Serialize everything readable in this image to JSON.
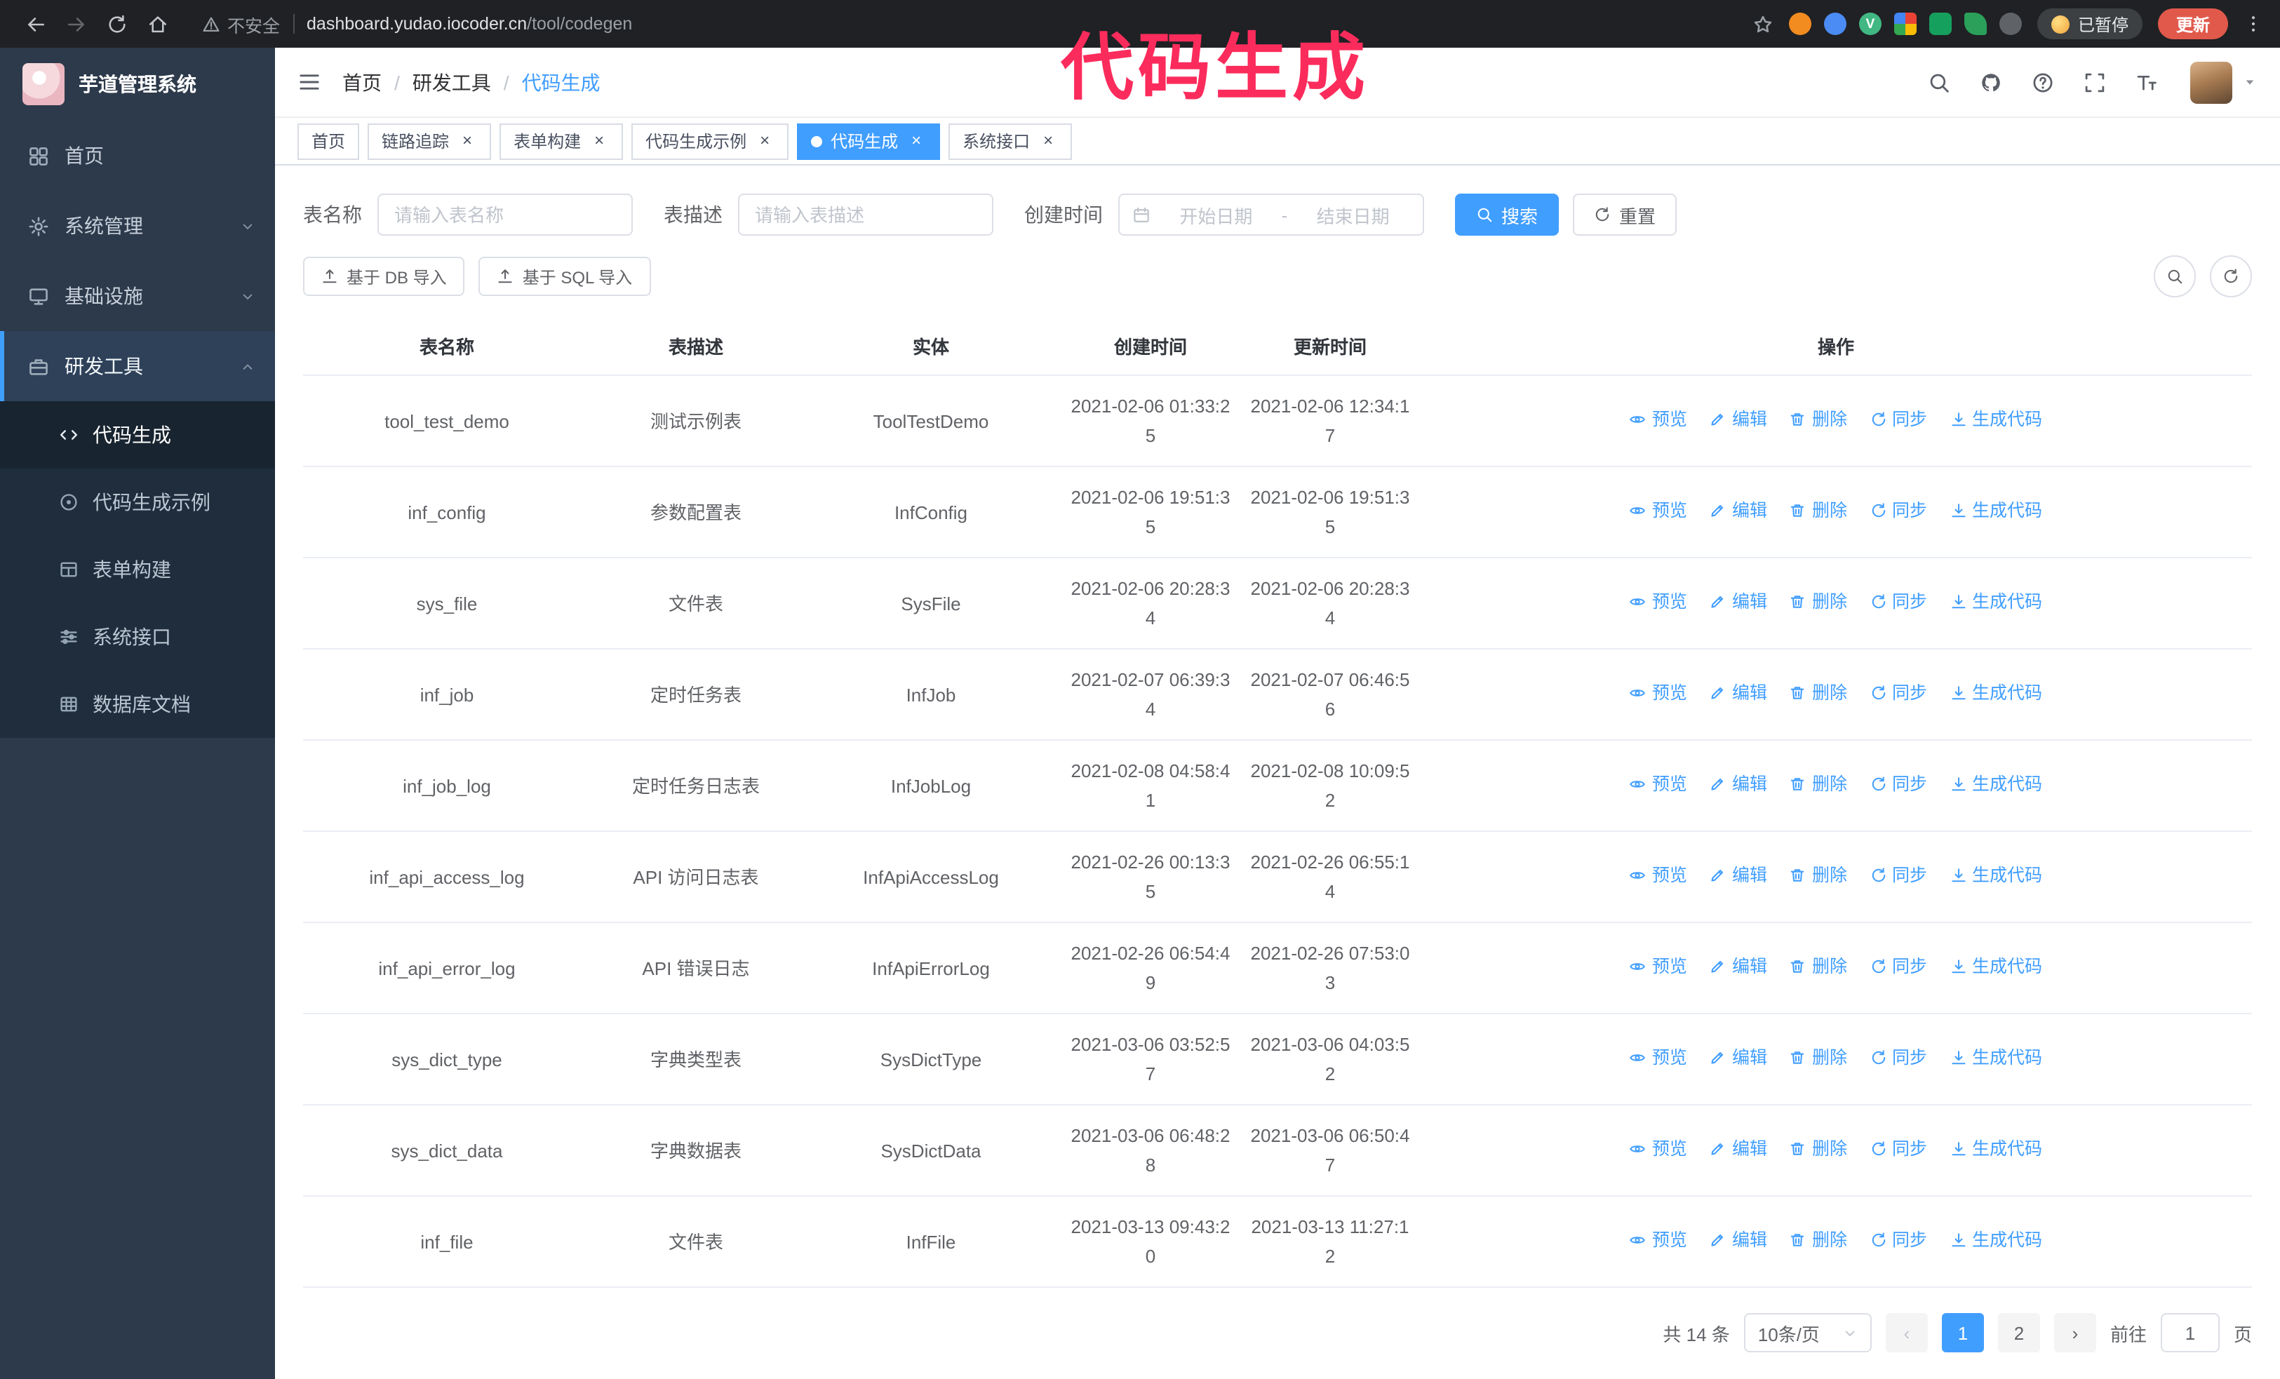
{
  "colors": {
    "primary": "#409EFF",
    "annotation": "#fb2c5c"
  },
  "annotation": {
    "text": "代码生成"
  },
  "browser": {
    "insecure_label": "不安全",
    "url_host": "dashboard.yudao.iocoder.cn",
    "url_path": "/tool/codegen",
    "paused_badge": "已暂停",
    "update_button": "更新",
    "extensions": [
      {
        "key": "orange",
        "shape": "circle",
        "color": "#f28b20"
      },
      {
        "key": "blue",
        "shape": "circle",
        "color": "#4b8bf4"
      },
      {
        "key": "vue-devtools",
        "shape": "circle",
        "color": "#41b883",
        "letter": "V"
      },
      {
        "key": "color-grid",
        "shape": "grid"
      },
      {
        "key": "green",
        "shape": "square",
        "color": "#16a05d"
      },
      {
        "key": "leaf",
        "shape": "leaf",
        "color": "#2aa05a"
      },
      {
        "key": "puzzle",
        "shape": "circle",
        "color": "#5f6368"
      }
    ]
  },
  "sidebar": {
    "logo_title": "芋道管理系统",
    "items": [
      {
        "key": "home",
        "label": "首页",
        "icon": "dashboard-icon",
        "expandable": false,
        "expanded": false
      },
      {
        "key": "system",
        "label": "系统管理",
        "icon": "gear-icon",
        "expandable": true,
        "expanded": false
      },
      {
        "key": "infra",
        "label": "基础设施",
        "icon": "infra-icon",
        "expandable": true,
        "expanded": false
      },
      {
        "key": "devtools",
        "label": "研发工具",
        "icon": "tools-icon",
        "expandable": true,
        "expanded": true,
        "children": [
          {
            "key": "codegen",
            "label": "代码生成",
            "icon": "code-icon",
            "active": true
          },
          {
            "key": "codegen-example",
            "label": "代码生成示例",
            "icon": "example-icon",
            "active": false
          },
          {
            "key": "form-builder",
            "label": "表单构建",
            "icon": "form-icon",
            "active": false
          },
          {
            "key": "api-doc",
            "label": "系统接口",
            "icon": "api-icon",
            "active": false
          },
          {
            "key": "db-doc",
            "label": "数据库文档",
            "icon": "database-icon",
            "active": false
          }
        ]
      }
    ]
  },
  "navbar": {
    "breadcrumb": [
      "首页",
      "研发工具",
      "代码生成"
    ]
  },
  "tabs": [
    {
      "key": "home",
      "label": "首页",
      "closable": false,
      "active": false
    },
    {
      "key": "tracer",
      "label": "链路追踪",
      "closable": true,
      "active": false
    },
    {
      "key": "form-builder",
      "label": "表单构建",
      "closable": true,
      "active": false
    },
    {
      "key": "codegen-example",
      "label": "代码生成示例",
      "closable": true,
      "active": false
    },
    {
      "key": "codegen",
      "label": "代码生成",
      "closable": true,
      "active": true
    },
    {
      "key": "api-doc",
      "label": "系统接口",
      "closable": true,
      "active": false
    }
  ],
  "filters": {
    "table_name": {
      "label": "表名称",
      "placeholder": "请输入表名称",
      "value": ""
    },
    "table_desc": {
      "label": "表描述",
      "placeholder": "请输入表描述",
      "value": ""
    },
    "create_time": {
      "label": "创建时间",
      "start_placeholder": "开始日期",
      "separator": "-",
      "end_placeholder": "结束日期"
    },
    "search_button": "搜索",
    "reset_button": "重置"
  },
  "toolbar": {
    "import_db_label": "基于 DB 导入",
    "import_sql_label": "基于 SQL 导入"
  },
  "table": {
    "columns": [
      "表名称",
      "表描述",
      "实体",
      "创建时间",
      "更新时间",
      "操作"
    ],
    "row_actions": [
      {
        "key": "preview",
        "label": "预览",
        "icon": "eye-icon"
      },
      {
        "key": "edit",
        "label": "编辑",
        "icon": "edit-icon"
      },
      {
        "key": "delete",
        "label": "删除",
        "icon": "delete-icon"
      },
      {
        "key": "sync",
        "label": "同步",
        "icon": "sync-icon"
      },
      {
        "key": "generate",
        "label": "生成代码",
        "icon": "download-icon"
      }
    ],
    "rows": [
      {
        "name": "tool_test_demo",
        "desc": "测试示例表",
        "entity": "ToolTestDemo",
        "created": "2021-02-06 01:33:25",
        "updated": "2021-02-06 12:34:17"
      },
      {
        "name": "inf_config",
        "desc": "参数配置表",
        "entity": "InfConfig",
        "created": "2021-02-06 19:51:35",
        "updated": "2021-02-06 19:51:35"
      },
      {
        "name": "sys_file",
        "desc": "文件表",
        "entity": "SysFile",
        "created": "2021-02-06 20:28:34",
        "updated": "2021-02-06 20:28:34"
      },
      {
        "name": "inf_job",
        "desc": "定时任务表",
        "entity": "InfJob",
        "created": "2021-02-07 06:39:34",
        "updated": "2021-02-07 06:46:56"
      },
      {
        "name": "inf_job_log",
        "desc": "定时任务日志表",
        "entity": "InfJobLog",
        "created": "2021-02-08 04:58:41",
        "updated": "2021-02-08 10:09:52"
      },
      {
        "name": "inf_api_access_log",
        "desc": "API 访问日志表",
        "entity": "InfApiAccessLog",
        "created": "2021-02-26 00:13:35",
        "updated": "2021-02-26 06:55:14"
      },
      {
        "name": "inf_api_error_log",
        "desc": "API 错误日志",
        "entity": "InfApiErrorLog",
        "created": "2021-02-26 06:54:49",
        "updated": "2021-02-26 07:53:03"
      },
      {
        "name": "sys_dict_type",
        "desc": "字典类型表",
        "entity": "SysDictType",
        "created": "2021-03-06 03:52:57",
        "updated": "2021-03-06 04:03:52"
      },
      {
        "name": "sys_dict_data",
        "desc": "字典数据表",
        "entity": "SysDictData",
        "created": "2021-03-06 06:48:28",
        "updated": "2021-03-06 06:50:47"
      },
      {
        "name": "inf_file",
        "desc": "文件表",
        "entity": "InfFile",
        "created": "2021-03-13 09:43:20",
        "updated": "2021-03-13 11:27:12"
      }
    ]
  },
  "pagination": {
    "total": "共 14 条",
    "page_size": "10条/页",
    "prev": "‹",
    "next": "›",
    "pages": [
      "1",
      "2"
    ],
    "active_page": "1",
    "goto_label": "前往",
    "goto_value": "1",
    "goto_unit": "页"
  }
}
